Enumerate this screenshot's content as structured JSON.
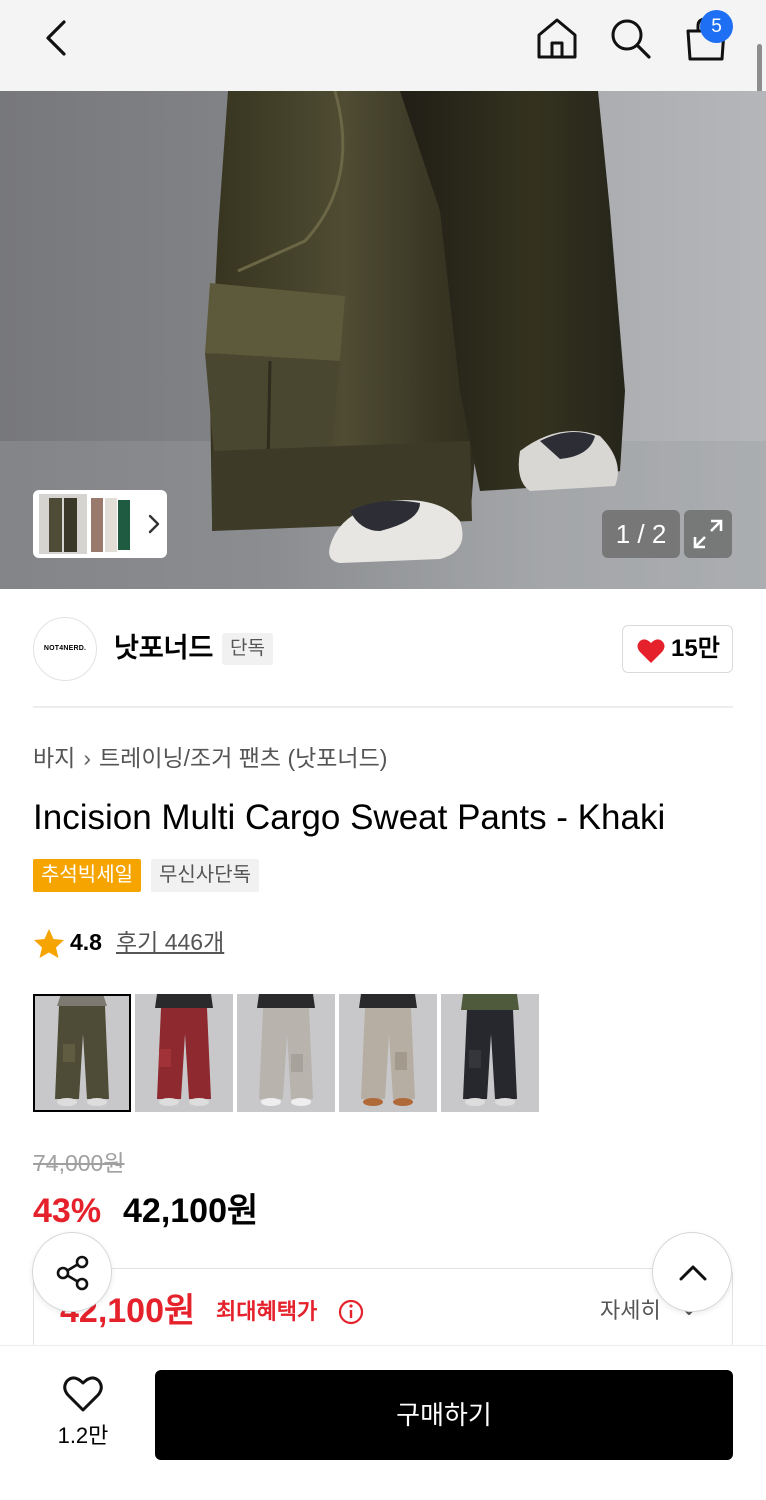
{
  "header": {
    "cart_count": "5"
  },
  "gallery": {
    "counter": "1 / 2"
  },
  "brand": {
    "logo_text": "NOT4NERD.",
    "name": "낫포너드",
    "tag": "단독",
    "likes": "15만"
  },
  "product": {
    "breadcrumb": [
      "바지",
      "트레이닝/조거 팬츠 (낫포너드)"
    ],
    "title": "Incision Multi Cargo Sweat Pants - Khaki",
    "badges": {
      "sale": "추석빅세일",
      "exclusive": "무신사단독"
    },
    "rating": "4.8",
    "reviews": "후기 446개"
  },
  "color_options": [
    "khaki",
    "burgundy",
    "light-grey",
    "beige",
    "black"
  ],
  "colors": {
    "khaki": "#4e4b36",
    "burgundy": "#8e2a2f",
    "light_grey": "#b9b3ae",
    "beige": "#b6aea2",
    "black": "#26282d",
    "accent_red": "#e5222c",
    "badge_orange": "#f5a400",
    "cart_badge_blue": "#1e6ff3"
  },
  "price": {
    "original": "74,000원",
    "discount": "43%",
    "current": "42,100원"
  },
  "benefit": {
    "price": "42,100원",
    "label": "최대혜택가",
    "more": "자세히"
  },
  "bottom": {
    "wish_count": "1.2만",
    "buy_label": "구매하기"
  }
}
